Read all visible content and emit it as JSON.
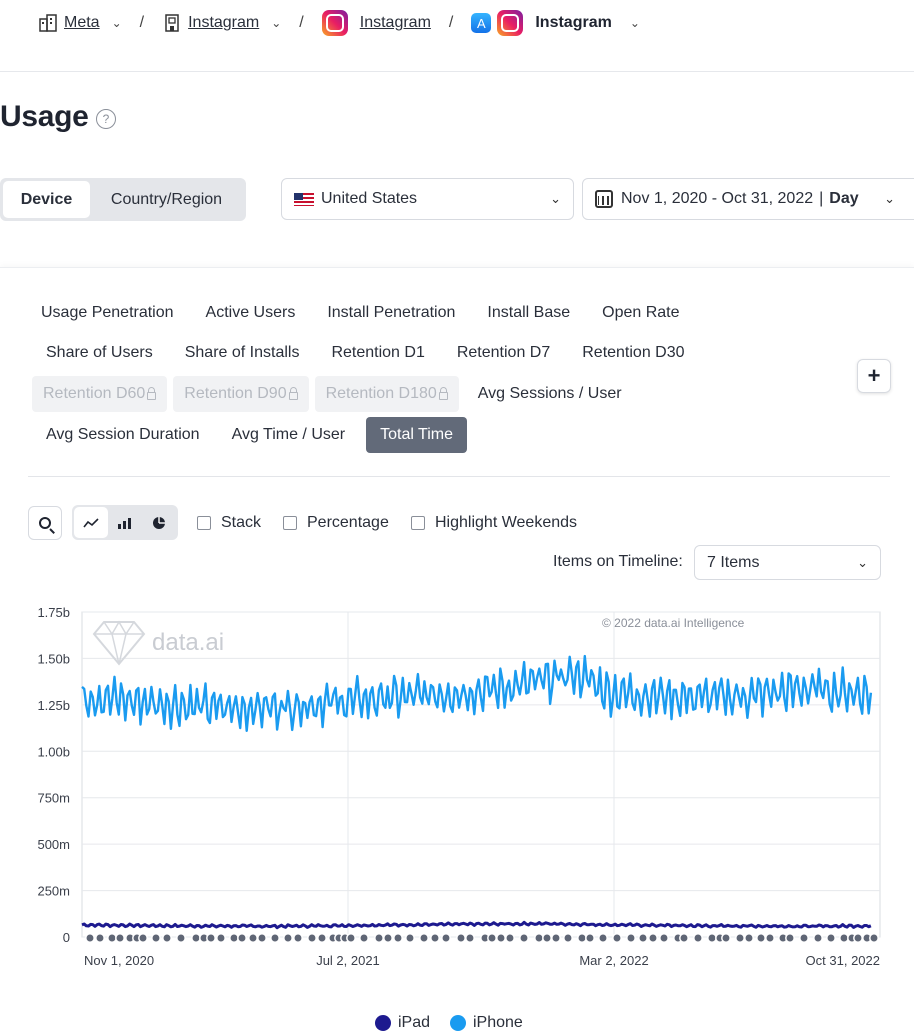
{
  "breadcrumb": {
    "company": "Meta",
    "unified_app": "Instagram",
    "app": "Instagram",
    "platform_app": "Instagram"
  },
  "page": {
    "title": "Usage",
    "help_icon": "?"
  },
  "segment": {
    "device": "Device",
    "country": "Country/Region"
  },
  "country_select": {
    "value": "United States"
  },
  "date_select": {
    "range": "Nov 1, 2020 - Oct 31, 2022",
    "separator": "|",
    "granularity": "Day"
  },
  "metrics": {
    "row1": [
      "Usage Penetration",
      "Active Users",
      "Install Penetration",
      "Install Base",
      "Open Rate"
    ],
    "row2": [
      "Share of Users",
      "Share of Installs",
      "Retention D1",
      "Retention D7",
      "Retention D30"
    ],
    "row3_locked": [
      "Retention D60",
      "Retention D90",
      "Retention D180"
    ],
    "row3": [
      "Avg Sessions / User"
    ],
    "row4": [
      "Avg Session Duration",
      "Avg Time / User"
    ],
    "active": "Total Time"
  },
  "toolbar": {
    "stack": "Stack",
    "percentage": "Percentage",
    "highlight_weekends": "Highlight Weekends",
    "items_on_timeline_label": "Items on Timeline:",
    "items_on_timeline_value": "7 Items",
    "add_label": "+"
  },
  "chart_data": {
    "type": "line",
    "watermark": "data.ai",
    "copyright": "© 2022 data.ai Intelligence",
    "y_ticks": [
      "1.75b",
      "1.50b",
      "1.25b",
      "1.00b",
      "750m",
      "500m",
      "250m",
      "0"
    ],
    "ylim": [
      0,
      1750000000
    ],
    "x_ticks": [
      "Nov 1, 2020",
      "Jul 2, 2021",
      "Mar 2, 2022",
      "Oct 31, 2022"
    ],
    "x_range": [
      "2020-11-01",
      "2022-10-31"
    ],
    "grid": true,
    "legend_position": "bottom-center",
    "series": [
      {
        "name": "iPad",
        "color": "#1d1a8f",
        "x": [
          "2020-11-01",
          "2021-02-01",
          "2021-05-01",
          "2021-07-02",
          "2021-10-01",
          "2022-01-01",
          "2022-03-02",
          "2022-06-01",
          "2022-09-01",
          "2022-10-31"
        ],
        "values": [
          65000000,
          60000000,
          58000000,
          62000000,
          68000000,
          72000000,
          66000000,
          60000000,
          58000000,
          60000000
        ]
      },
      {
        "name": "iPhone",
        "color": "#1a9bf0",
        "x": [
          "2020-11-01",
          "2020-12-15",
          "2021-02-01",
          "2021-03-15",
          "2021-05-01",
          "2021-07-02",
          "2021-08-15",
          "2021-10-01",
          "2021-11-15",
          "2022-01-01",
          "2022-02-01",
          "2022-03-02",
          "2022-04-15",
          "2022-06-01",
          "2022-07-15",
          "2022-09-01",
          "2022-10-31"
        ],
        "values": [
          1300000000,
          1270000000,
          1250000000,
          1230000000,
          1240000000,
          1270000000,
          1290000000,
          1310000000,
          1330000000,
          1380000000,
          1420000000,
          1320000000,
          1300000000,
          1290000000,
          1300000000,
          1340000000,
          1310000000
        ]
      }
    ]
  },
  "legend": [
    {
      "name": "iPad",
      "color": "#1d1a8f"
    },
    {
      "name": "iPhone",
      "color": "#1a9bf0"
    }
  ]
}
